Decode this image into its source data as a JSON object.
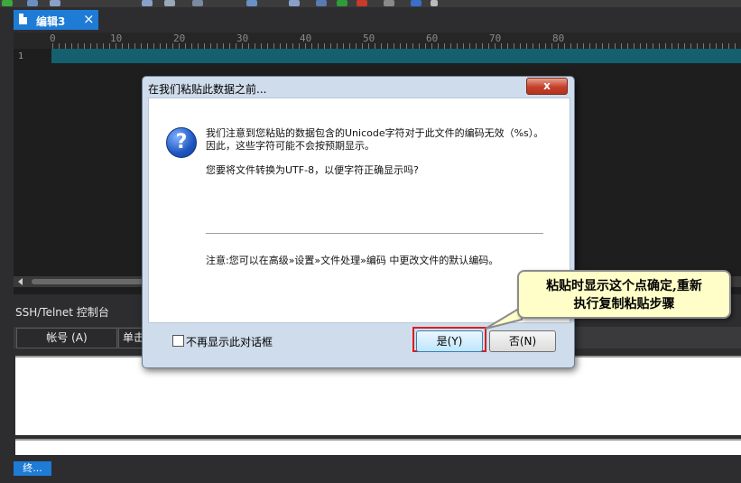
{
  "editor": {
    "tab_label": "编辑3",
    "tab_close": "×",
    "ruler_marks": [
      "0",
      "10",
      "20",
      "30",
      "40",
      "50",
      "60",
      "70",
      "80"
    ],
    "line_number": "1"
  },
  "ssh": {
    "title": "SSH/Telnet 控制台",
    "col_account": "帐号 (A)",
    "col_single": "单击",
    "end_button": "终..."
  },
  "dialog": {
    "title": "在我们粘贴此数据之前...",
    "close": "x",
    "message_line1": "我们注意到您粘贴的数据包含的Unicode字符对于此文件的编码无效（%s）。因此，这些字符可能不会按预期显示。",
    "message_line2": "您要将文件转换为UTF-8，以便字符正确显示吗?",
    "note": "注意:您可以在高级»设置»文件处理»编码 中更改文件的默认编码。",
    "checkbox_label": "不再显示此对话框",
    "yes_label": "是(Y)",
    "no_label": "否(N)"
  },
  "callout": {
    "line1": "粘贴时显示这个点确定,重新",
    "line2": "执行复制粘贴步骤"
  },
  "colors": {
    "tab_active": "#1e7bd6",
    "highlight_outline": "#d42020",
    "callout_bg": "#fffec8"
  }
}
